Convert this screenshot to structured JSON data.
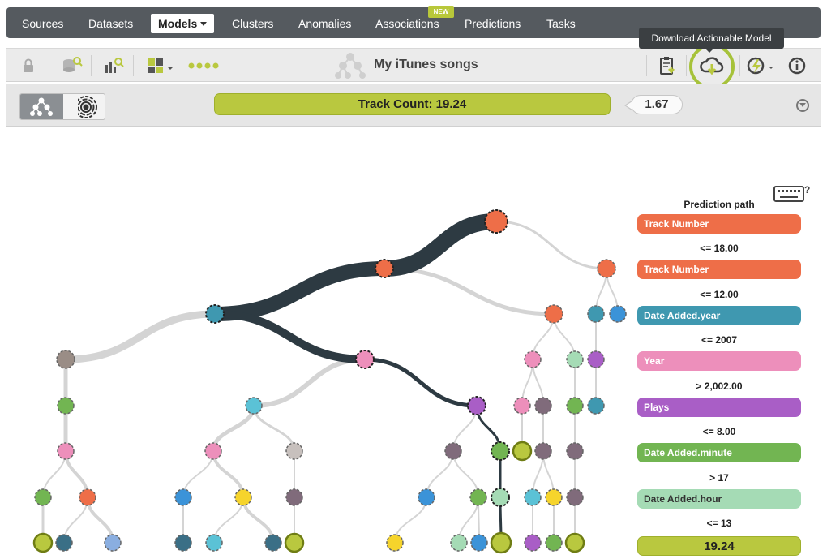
{
  "nav": {
    "items": [
      {
        "label": "Sources"
      },
      {
        "label": "Datasets"
      },
      {
        "label": "Models"
      },
      {
        "label": "Clusters"
      },
      {
        "label": "Anomalies"
      },
      {
        "label": "Associations"
      },
      {
        "label": "Predictions"
      },
      {
        "label": "Tasks"
      }
    ],
    "active": "Models",
    "new_badge": "NEW"
  },
  "tooltip": "Download Actionable Model",
  "toolbar": {
    "title": "My iTunes songs",
    "icons": [
      "lock-icon",
      "dataset-search-icon",
      "bar-chart-search-icon",
      "filter-icon",
      "dots-icon",
      "model-tree-icon",
      "clipboard-download-icon",
      "cloud-download-icon",
      "lightning-icon",
      "info-icon"
    ]
  },
  "prediction": {
    "label": "Track Count: 19.24",
    "confidence": "1.67"
  },
  "colors": {
    "accent": "#b9c83f",
    "highlight_ring": "#a6c23a",
    "path_dark": "#2d3a42",
    "branch_light": "#d4d4d4"
  },
  "path_panel": {
    "title": "Prediction path",
    "steps": [
      {
        "field": "Track Number",
        "color": "#ee6e48",
        "condition": "<= 18.00"
      },
      {
        "field": "Track Number",
        "color": "#ee6e48",
        "condition": "<= 12.00"
      },
      {
        "field": "Date Added.year",
        "color": "#3f98b0",
        "condition": "<= 2007"
      },
      {
        "field": "Year",
        "color": "#ed8fbb",
        "condition": "> 2,002.00"
      },
      {
        "field": "Plays",
        "color": "#a95ec6",
        "condition": "<= 8.00"
      },
      {
        "field": "Date Added.minute",
        "color": "#72b552",
        "condition": "> 17"
      },
      {
        "field": "Date Added.hour",
        "color": "#a5dbb5",
        "condition": "<= 13"
      }
    ],
    "result": "19.24"
  },
  "tree": {
    "path_color": "#2d3a42",
    "branch_color": "#d4d4d4"
  }
}
